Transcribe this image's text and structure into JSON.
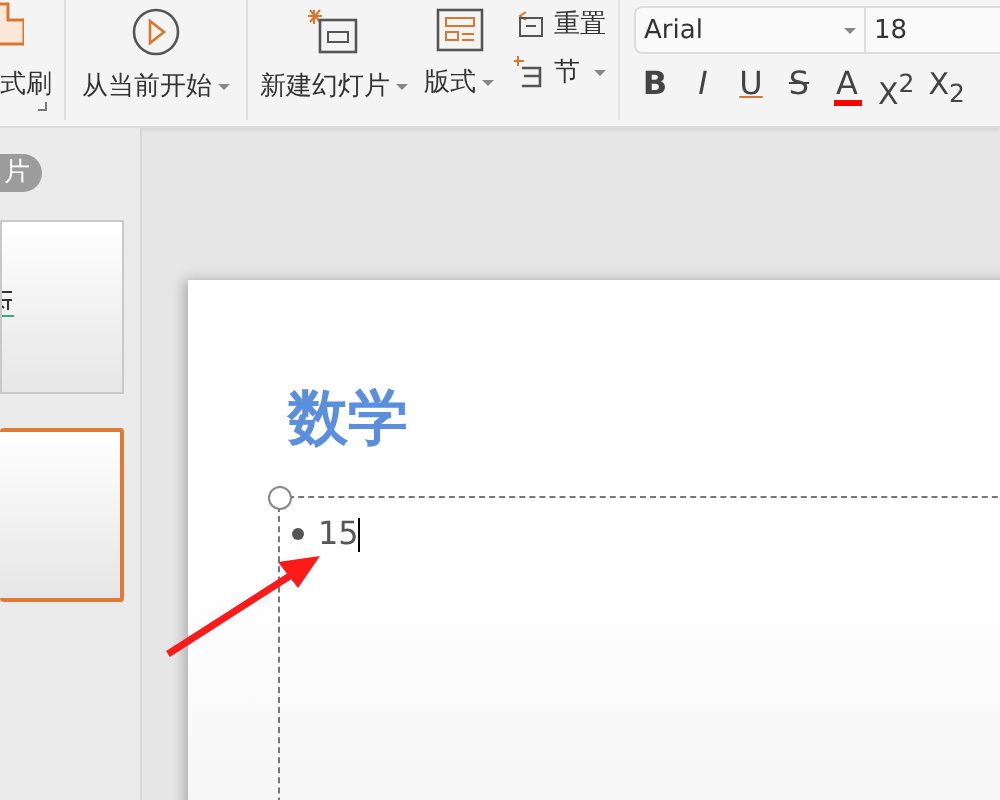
{
  "ribbon": {
    "format_painter": {
      "label": "式刷"
    },
    "play_from_current": {
      "label": "从当前开始",
      "has_menu": true
    },
    "new_slide": {
      "label": "新建幻灯片",
      "has_menu": true
    },
    "layout": {
      "label": "版式",
      "has_menu": true
    },
    "reset": {
      "label": "重置"
    },
    "section": {
      "label": "节",
      "has_menu": true
    },
    "font_name": "Arial",
    "font_size": "18",
    "format_buttons": [
      {
        "kind": "bold",
        "label": "B"
      },
      {
        "kind": "italic",
        "label": "I"
      },
      {
        "kind": "underline",
        "label": "U"
      },
      {
        "kind": "strike",
        "label": "S"
      },
      {
        "kind": "color",
        "label": "A",
        "color": "#ff0000"
      },
      {
        "kind": "super",
        "label": "X$^{2}$"
      },
      {
        "kind": "sub",
        "label": "X$_{2}$"
      }
    ]
  },
  "panel": {
    "tab": "片",
    "thumbnails": [
      {
        "selected": false
      },
      {
        "selected": true
      }
    ]
  },
  "slide": {
    "title": "数学",
    "bullets": [
      "15"
    ]
  }
}
